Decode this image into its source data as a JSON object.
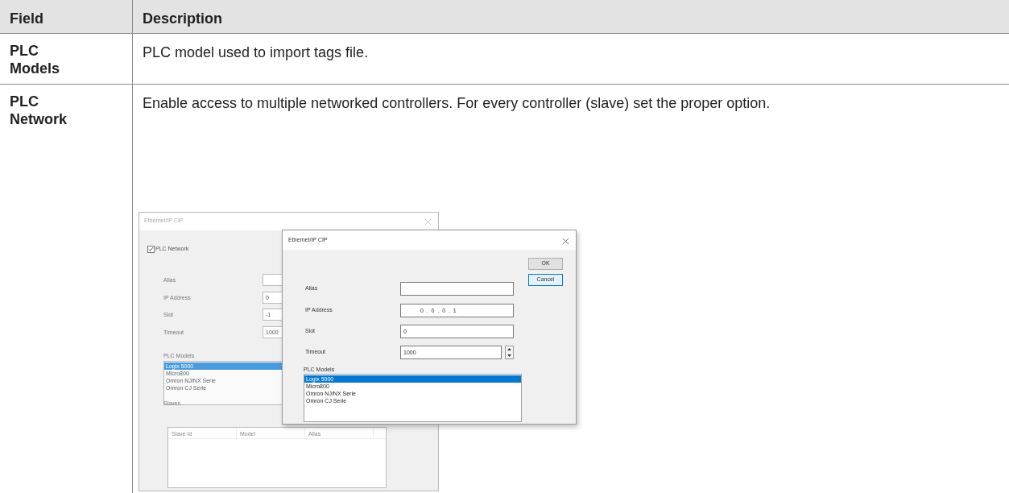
{
  "table": {
    "columns": [
      "Field",
      "Description"
    ],
    "rows": [
      {
        "field": "PLC Models",
        "description": "PLC model used to import tags file."
      },
      {
        "field": "PLC Network",
        "description": "Enable access to multiple networked controllers. For every controller (slave) set the proper option.",
        "figure": {
          "back_dialog": {
            "title": "Ethernet/IP CIP",
            "plc_network": {
              "label": "PLC Network",
              "checked": true
            },
            "fields": [
              {
                "label": "Alias"
              },
              {
                "label": "IP Address",
                "value": "0"
              },
              {
                "label": "Slot",
                "value": "-1"
              },
              {
                "label": "Timeout",
                "value": "1000"
              }
            ],
            "models_label": "PLC Models",
            "models": [
              {
                "label": "Logix 5000",
                "selected": true
              },
              {
                "label": "Micro800",
                "selected": false
              },
              {
                "label": "Omron NJ/NX Serie",
                "selected": false
              },
              {
                "label": "Omron CJ Serie",
                "selected": false
              }
            ],
            "slaves_label": "Slaves",
            "slaves_columns": [
              "Slave Id",
              "Model",
              "Alias"
            ]
          },
          "front_dialog": {
            "title": "Ethernet/IP CIP",
            "buttons": [
              "OK",
              "Cancel"
            ],
            "fields": [
              {
                "label": "Alias",
                "kind": "text"
              },
              {
                "label": "IP Address",
                "value": "0  .  0  .  0  .  1",
                "kind": "ip"
              },
              {
                "label": "Slot",
                "value": "0",
                "kind": "text"
              },
              {
                "label": "Timeout",
                "value": "1000",
                "kind": "spin"
              }
            ],
            "models_label": "PLC Models",
            "models": [
              {
                "label": "Logix 5000",
                "selected": true
              },
              {
                "label": "Micro800",
                "selected": false
              },
              {
                "label": "Omron NJ/NX Serie",
                "selected": false
              },
              {
                "label": "Omron CJ Serie",
                "selected": false
              }
            ]
          }
        }
      }
    ]
  }
}
